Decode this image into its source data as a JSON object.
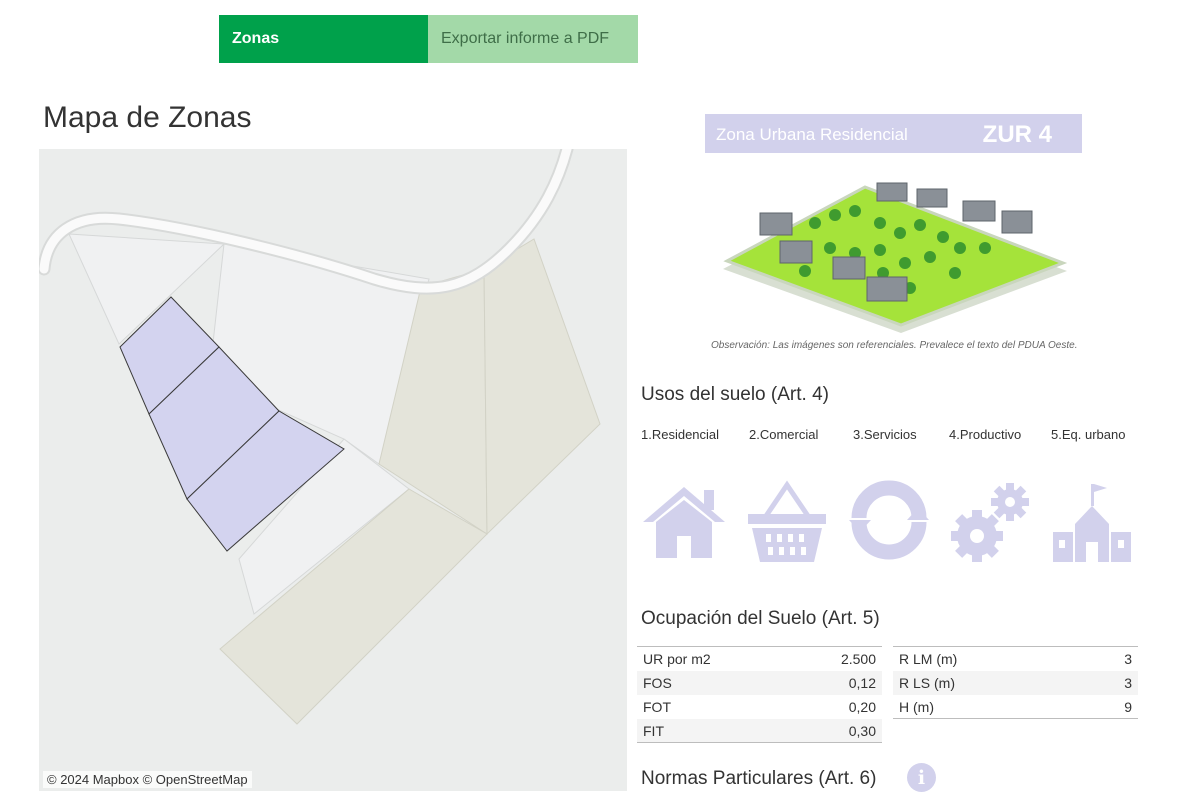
{
  "tabs": [
    {
      "label": "Zonas",
      "active": true
    },
    {
      "label": "Exportar informe a PDF",
      "active": false
    }
  ],
  "map": {
    "title": "Mapa de Zonas",
    "attribution": "© 2024 Mapbox © OpenStreetMap"
  },
  "zone": {
    "label": "Zona Urbana Residencial",
    "code": "ZUR 4",
    "note": "Observación: Las imágenes son referenciales. Prevalece el texto del PDUA Oeste."
  },
  "uses": {
    "title": "Usos del suelo (Art. 4)",
    "items": [
      {
        "label": "1.Residencial",
        "icon": "house-icon"
      },
      {
        "label": "2.Comercial",
        "icon": "basket-icon"
      },
      {
        "label": "3.Servicios",
        "icon": "services-cycle-icon"
      },
      {
        "label": "4.Productivo",
        "icon": "gears-icon"
      },
      {
        "label": "5.Eq. urbano",
        "icon": "school-building-icon"
      }
    ]
  },
  "occupation": {
    "title": "Ocupación del Suelo (Art. 5)",
    "left": [
      {
        "name": "UR por m2",
        "value": "2.500"
      },
      {
        "name": "FOS",
        "value": "0,12"
      },
      {
        "name": "FOT",
        "value": "0,20"
      },
      {
        "name": "FIT",
        "value": "0,30"
      }
    ],
    "right": [
      {
        "name": "R LM  (m)",
        "value": "3"
      },
      {
        "name": "R LS  (m)",
        "value": "3"
      },
      {
        "name": "H (m)",
        "value": "9"
      }
    ]
  },
  "norms": {
    "title": "Normas Particulares (Art. 6)",
    "info_icon": "i"
  },
  "colors": {
    "tab_active": "#00a14b",
    "tab_inactive": "#a3d9a8",
    "zone_fill": "#d2d1ec",
    "icon_color": "#d2d1ec"
  }
}
